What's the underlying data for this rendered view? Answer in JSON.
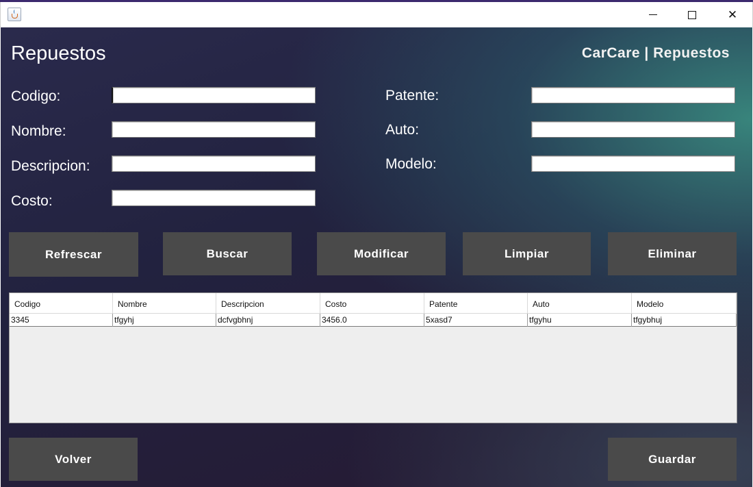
{
  "window": {
    "close_glyph": "✕"
  },
  "header": {
    "title": "Repuestos",
    "brand": "CarCare | Repuestos"
  },
  "form": {
    "left": [
      {
        "label": "Codigo:",
        "value": ""
      },
      {
        "label": "Nombre:",
        "value": ""
      },
      {
        "label": "Descripcion:",
        "value": ""
      },
      {
        "label": "Costo:",
        "value": ""
      }
    ],
    "right": [
      {
        "label": "Patente:",
        "value": ""
      },
      {
        "label": "Auto:",
        "value": ""
      },
      {
        "label": "Modelo:",
        "value": ""
      }
    ]
  },
  "actions": {
    "refrescar": "Refrescar",
    "buscar": "Buscar",
    "modificar": "Modificar",
    "limpiar": "Limpiar",
    "eliminar": "Eliminar"
  },
  "table": {
    "columns": [
      "Codigo",
      "Nombre",
      "Descripcion",
      "Costo",
      "Patente",
      "Auto",
      "Modelo"
    ],
    "rows": [
      [
        "3345",
        "tfgyhj",
        "dcfvgbhnj",
        "3456.0",
        "5xasd7",
        "tfgyhu",
        "tfgybhuj"
      ]
    ]
  },
  "footer": {
    "volver": "Volver",
    "guardar": "Guardar"
  },
  "colors": {
    "button_bg": "#4a4a4a",
    "accent_top": "#3c2a6e"
  }
}
